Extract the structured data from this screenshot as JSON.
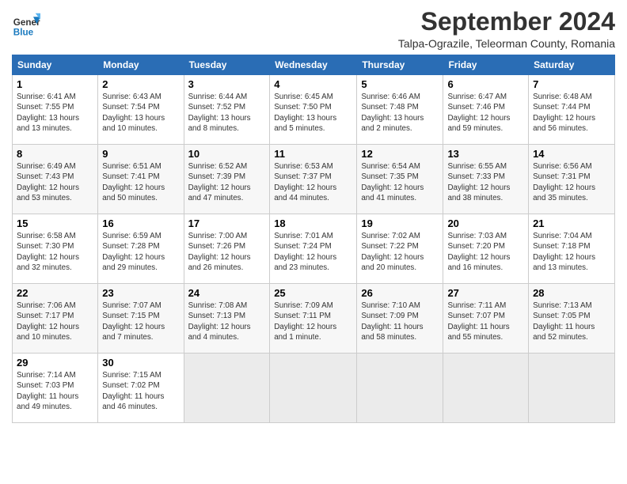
{
  "header": {
    "logo_line1": "General",
    "logo_line2": "Blue",
    "month_title": "September 2024",
    "subtitle": "Talpa-Ograzile, Teleorman County, Romania"
  },
  "weekdays": [
    "Sunday",
    "Monday",
    "Tuesday",
    "Wednesday",
    "Thursday",
    "Friday",
    "Saturday"
  ],
  "weeks": [
    [
      {
        "day": "1",
        "info": "Sunrise: 6:41 AM\nSunset: 7:55 PM\nDaylight: 13 hours\nand 13 minutes."
      },
      {
        "day": "2",
        "info": "Sunrise: 6:43 AM\nSunset: 7:54 PM\nDaylight: 13 hours\nand 10 minutes."
      },
      {
        "day": "3",
        "info": "Sunrise: 6:44 AM\nSunset: 7:52 PM\nDaylight: 13 hours\nand 8 minutes."
      },
      {
        "day": "4",
        "info": "Sunrise: 6:45 AM\nSunset: 7:50 PM\nDaylight: 13 hours\nand 5 minutes."
      },
      {
        "day": "5",
        "info": "Sunrise: 6:46 AM\nSunset: 7:48 PM\nDaylight: 13 hours\nand 2 minutes."
      },
      {
        "day": "6",
        "info": "Sunrise: 6:47 AM\nSunset: 7:46 PM\nDaylight: 12 hours\nand 59 minutes."
      },
      {
        "day": "7",
        "info": "Sunrise: 6:48 AM\nSunset: 7:44 PM\nDaylight: 12 hours\nand 56 minutes."
      }
    ],
    [
      {
        "day": "8",
        "info": "Sunrise: 6:49 AM\nSunset: 7:43 PM\nDaylight: 12 hours\nand 53 minutes."
      },
      {
        "day": "9",
        "info": "Sunrise: 6:51 AM\nSunset: 7:41 PM\nDaylight: 12 hours\nand 50 minutes."
      },
      {
        "day": "10",
        "info": "Sunrise: 6:52 AM\nSunset: 7:39 PM\nDaylight: 12 hours\nand 47 minutes."
      },
      {
        "day": "11",
        "info": "Sunrise: 6:53 AM\nSunset: 7:37 PM\nDaylight: 12 hours\nand 44 minutes."
      },
      {
        "day": "12",
        "info": "Sunrise: 6:54 AM\nSunset: 7:35 PM\nDaylight: 12 hours\nand 41 minutes."
      },
      {
        "day": "13",
        "info": "Sunrise: 6:55 AM\nSunset: 7:33 PM\nDaylight: 12 hours\nand 38 minutes."
      },
      {
        "day": "14",
        "info": "Sunrise: 6:56 AM\nSunset: 7:31 PM\nDaylight: 12 hours\nand 35 minutes."
      }
    ],
    [
      {
        "day": "15",
        "info": "Sunrise: 6:58 AM\nSunset: 7:30 PM\nDaylight: 12 hours\nand 32 minutes."
      },
      {
        "day": "16",
        "info": "Sunrise: 6:59 AM\nSunset: 7:28 PM\nDaylight: 12 hours\nand 29 minutes."
      },
      {
        "day": "17",
        "info": "Sunrise: 7:00 AM\nSunset: 7:26 PM\nDaylight: 12 hours\nand 26 minutes."
      },
      {
        "day": "18",
        "info": "Sunrise: 7:01 AM\nSunset: 7:24 PM\nDaylight: 12 hours\nand 23 minutes."
      },
      {
        "day": "19",
        "info": "Sunrise: 7:02 AM\nSunset: 7:22 PM\nDaylight: 12 hours\nand 20 minutes."
      },
      {
        "day": "20",
        "info": "Sunrise: 7:03 AM\nSunset: 7:20 PM\nDaylight: 12 hours\nand 16 minutes."
      },
      {
        "day": "21",
        "info": "Sunrise: 7:04 AM\nSunset: 7:18 PM\nDaylight: 12 hours\nand 13 minutes."
      }
    ],
    [
      {
        "day": "22",
        "info": "Sunrise: 7:06 AM\nSunset: 7:17 PM\nDaylight: 12 hours\nand 10 minutes."
      },
      {
        "day": "23",
        "info": "Sunrise: 7:07 AM\nSunset: 7:15 PM\nDaylight: 12 hours\nand 7 minutes."
      },
      {
        "day": "24",
        "info": "Sunrise: 7:08 AM\nSunset: 7:13 PM\nDaylight: 12 hours\nand 4 minutes."
      },
      {
        "day": "25",
        "info": "Sunrise: 7:09 AM\nSunset: 7:11 PM\nDaylight: 12 hours\nand 1 minute."
      },
      {
        "day": "26",
        "info": "Sunrise: 7:10 AM\nSunset: 7:09 PM\nDaylight: 11 hours\nand 58 minutes."
      },
      {
        "day": "27",
        "info": "Sunrise: 7:11 AM\nSunset: 7:07 PM\nDaylight: 11 hours\nand 55 minutes."
      },
      {
        "day": "28",
        "info": "Sunrise: 7:13 AM\nSunset: 7:05 PM\nDaylight: 11 hours\nand 52 minutes."
      }
    ],
    [
      {
        "day": "29",
        "info": "Sunrise: 7:14 AM\nSunset: 7:03 PM\nDaylight: 11 hours\nand 49 minutes."
      },
      {
        "day": "30",
        "info": "Sunrise: 7:15 AM\nSunset: 7:02 PM\nDaylight: 11 hours\nand 46 minutes."
      },
      {
        "day": "",
        "info": ""
      },
      {
        "day": "",
        "info": ""
      },
      {
        "day": "",
        "info": ""
      },
      {
        "day": "",
        "info": ""
      },
      {
        "day": "",
        "info": ""
      }
    ]
  ]
}
